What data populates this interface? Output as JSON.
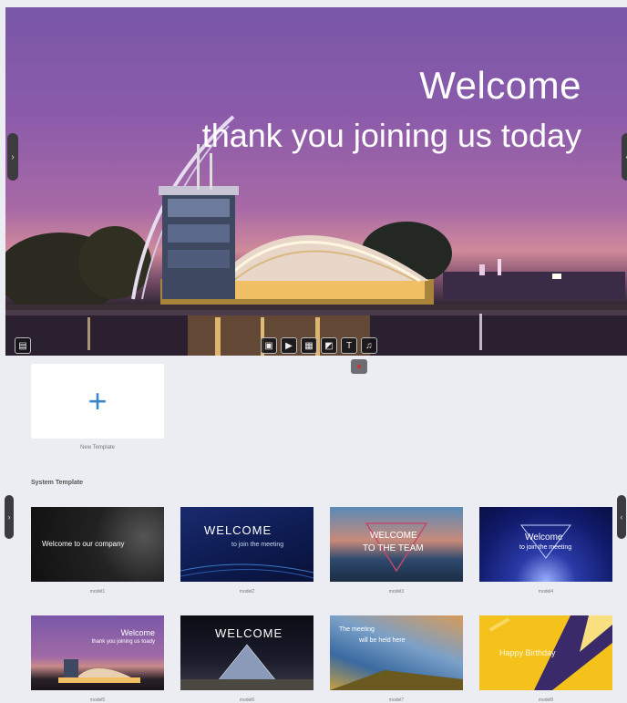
{
  "hero": {
    "title": "Welcome",
    "subtitle": "thank you joining us today",
    "left_tab_icon": "›",
    "right_tab_icon": "‹",
    "corner_icon": "layout-icon",
    "toolbar": [
      {
        "name": "save-icon",
        "glyph": "▣"
      },
      {
        "name": "present-icon",
        "glyph": "▶"
      },
      {
        "name": "background-icon",
        "glyph": "▦"
      },
      {
        "name": "image-icon",
        "glyph": "◩"
      },
      {
        "name": "text-icon",
        "glyph": "T"
      },
      {
        "name": "music-icon",
        "glyph": "♫"
      }
    ]
  },
  "new_template": {
    "plus": "+",
    "label": "New Template"
  },
  "section_title": "System Template",
  "templates": [
    {
      "label": "model1",
      "line1": "Welcome to our company",
      "line2": ""
    },
    {
      "label": "model2",
      "line1": "WELCOME",
      "line2": "to join the meeting"
    },
    {
      "label": "model3",
      "line1": "WELCOME",
      "line2": "TO THE TEAM"
    },
    {
      "label": "model4",
      "line1": "Welcome",
      "line2": "to join the meeting"
    },
    {
      "label": "model5",
      "line1": "Welcome",
      "line2": "thank you joining us toady"
    },
    {
      "label": "model6",
      "line1": "WELCOME",
      "line2": ""
    },
    {
      "label": "model7",
      "line1": "The meeting",
      "line2": "will be held here"
    },
    {
      "label": "model8",
      "line1": "Happy Birthday",
      "line2": ""
    }
  ],
  "page_left_icon": "›",
  "page_right_icon": "‹"
}
